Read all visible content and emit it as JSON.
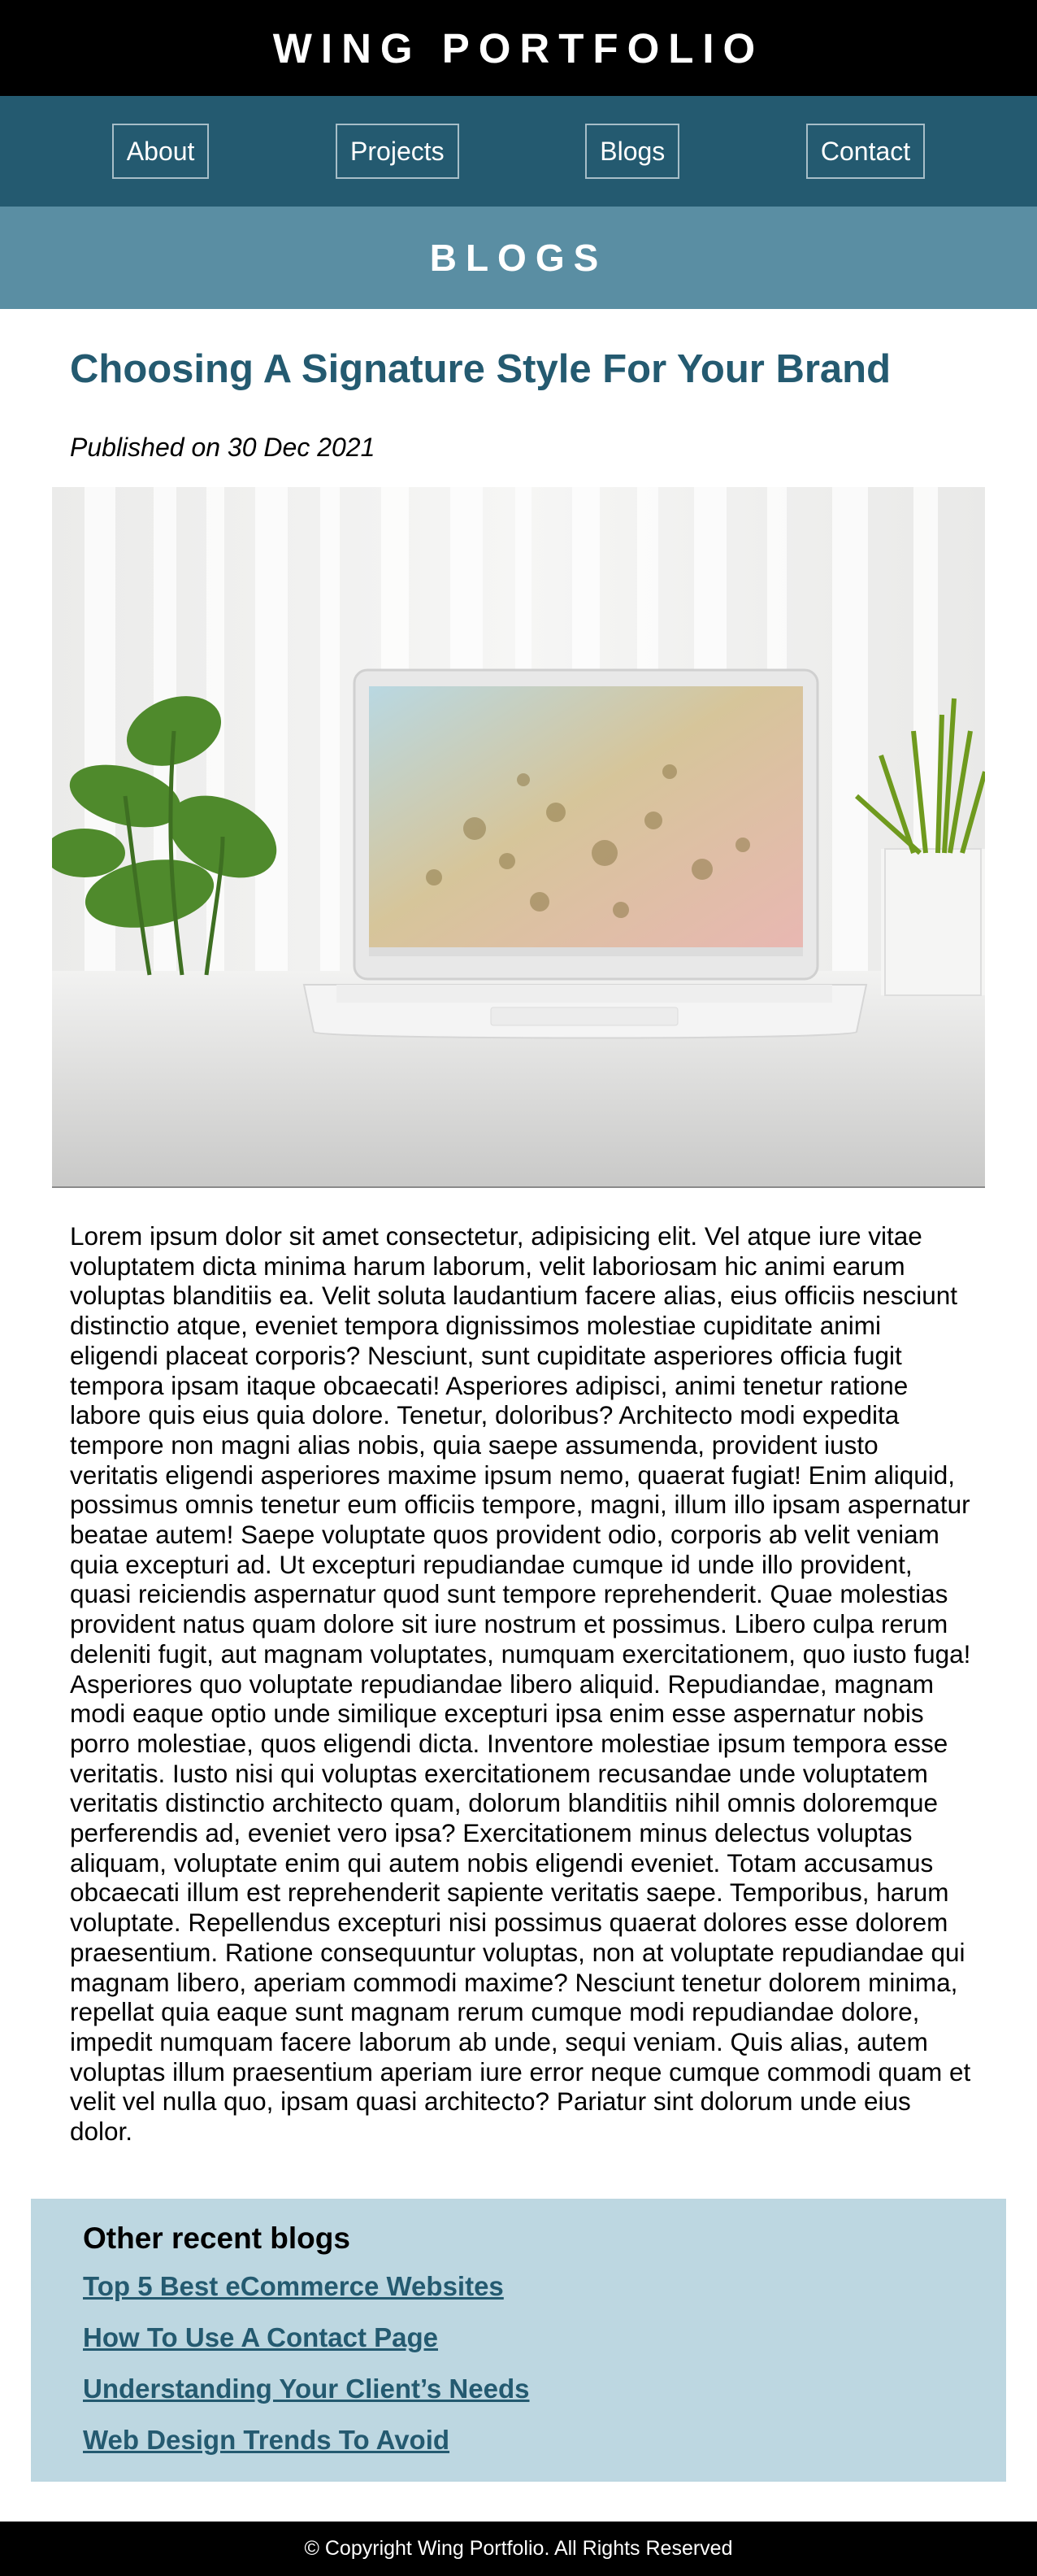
{
  "site": {
    "title": "WING PORTFOLIO"
  },
  "nav": {
    "items": [
      "About",
      "Projects",
      "Blogs",
      "Contact"
    ]
  },
  "section": {
    "title": "BLOGS"
  },
  "post": {
    "title": "Choosing A Signature Style For Your Brand",
    "date": "Published on 30 Dec 2021",
    "body": "Lorem ipsum dolor sit amet consectetur, adipisicing elit. Vel atque iure vitae voluptatem dicta minima harum laborum, velit laboriosam hic animi earum voluptas blanditiis ea. Velit soluta laudantium facere alias, eius officiis nesciunt distinctio atque, eveniet tempora dignissimos molestiae cupiditate animi eligendi placeat corporis? Nesciunt, sunt cupiditate asperiores officia fugit tempora ipsam itaque obcaecati! Asperiores adipisci, animi tenetur ratione labore quis eius quia dolore. Tenetur, doloribus? Architecto modi expedita tempore non magni alias nobis, quia saepe assumenda, provident iusto veritatis eligendi asperiores maxime ipsum nemo, quaerat fugiat! Enim aliquid, possimus omnis tenetur eum officiis tempore, magni, illum illo ipsam aspernatur beatae autem! Saepe voluptate quos provident odio, corporis ab velit veniam quia excepturi ad. Ut excepturi repudiandae cumque id unde illo provident, quasi reiciendis aspernatur quod sunt tempore reprehenderit. Quae molestias provident natus quam dolore sit iure nostrum et possimus. Libero culpa rerum deleniti fugit, aut magnam voluptates, numquam exercitationem, quo iusto fuga! Asperiores quo voluptate repudiandae libero aliquid. Repudiandae, magnam modi eaque optio unde similique excepturi ipsa enim esse aspernatur nobis porro molestiae, quos eligendi dicta. Inventore molestiae ipsum tempora esse veritatis. Iusto nisi qui voluptas exercitationem recusandae unde voluptatem veritatis distinctio architecto quam, dolorum blanditiis nihil omnis doloremque perferendis ad, eveniet vero ipsa? Exercitationem minus delectus voluptas aliquam, voluptate enim qui autem nobis eligendi eveniet. Totam accusamus obcaecati illum est reprehenderit sapiente veritatis saepe. Temporibus, harum voluptate. Repellendus excepturi nisi possimus quaerat dolores esse dolorem praesentium. Ratione consequuntur voluptas, non at voluptate repudiandae qui magnam libero, aperiam commodi maxime? Nesciunt tenetur dolorem minima, repellat quia eaque sunt magnam rerum cumque modi repudiandae dolore, impedit numquam facere laborum ab unde, sequi veniam. Quis alias, autem voluptas illum praesentium aperiam iure error neque cumque commodi quam et velit vel nulla quo, ipsam quasi architecto? Pariatur sint dolorum unde eius dolor."
  },
  "recent": {
    "heading": "Other recent blogs",
    "links": [
      "Top 5 Best eCommerce Websites",
      "How To Use A Contact Page",
      "Understanding Your Client’s Needs",
      "Web Design Trends To Avoid"
    ]
  },
  "footer": {
    "copyright": "© Copyright Wing Portfolio. All Rights Reserved"
  },
  "colors": {
    "header_bg": "#000000",
    "nav_bg": "#245a70",
    "banner_bg": "#5a8ea3",
    "accent": "#245a70",
    "recent_bg": "#bdd7e1"
  }
}
